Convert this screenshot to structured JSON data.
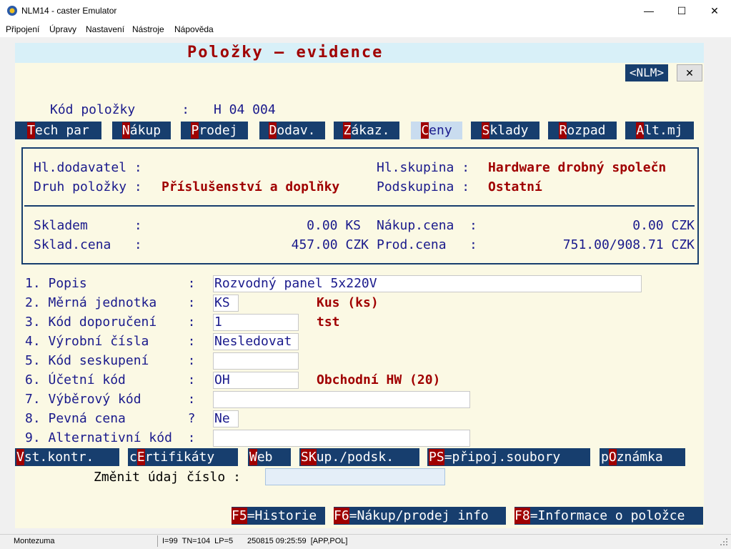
{
  "window": {
    "title": "NLM14 - caster Emulator",
    "minimize": "—",
    "maximize": "☐",
    "close": "✕"
  },
  "menu": [
    "Připojení",
    "Úpravy",
    "Nastavení",
    "Nástroje",
    "Nápověda"
  ],
  "screen": {
    "heading": "Položky – evidence",
    "nlm_tag": "<NLM>",
    "close_x": "✕",
    "item_code_label": "Kód položky      :",
    "item_code_value": "H 04 004"
  },
  "tabs": [
    {
      "key": "T",
      "rest": "ech par"
    },
    {
      "key": "N",
      "rest": "ákup"
    },
    {
      "key": "P",
      "rest": "rodej"
    },
    {
      "key": "D",
      "rest": "odav."
    },
    {
      "key": "Z",
      "rest": "ákaz."
    },
    {
      "key": "C",
      "rest": "eny",
      "active": true
    },
    {
      "key": "S",
      "rest": "klady"
    },
    {
      "key": "R",
      "rest": "ozpad"
    },
    {
      "key": "A",
      "rest": "lt.mj"
    }
  ],
  "info": {
    "hl_dodavatel_label": "Hl.dodavatel :",
    "hl_dodavatel_value": "",
    "druh_label": "Druh položky :",
    "druh_value": "Příslušenství a doplňky",
    "hl_skupina_label": "Hl.skupina :",
    "hl_skupina_value": "Hardware drobný společn",
    "podskupina_label": "Podskupina :",
    "podskupina_value": "Ostatní",
    "skladem_label": "Skladem      :",
    "skladem_value": "0.00 KS",
    "sklad_cena_label": "Sklad.cena   :",
    "sklad_cena_value": "457.00 CZK",
    "nakup_cena_label": "Nákup.cena  :",
    "nakup_cena_value": "0.00 CZK",
    "prod_cena_label": "Prod.cena   :",
    "prod_cena_value": "751.00/908.71 CZK"
  },
  "fields": [
    {
      "label": "1. Popis             :",
      "value": "Rozvodný panel 5x220V",
      "note": ""
    },
    {
      "label": "2. Měrná jednotka    :",
      "value": "KS",
      "note": "Kus (ks)"
    },
    {
      "label": "3. Kód doporučení    :",
      "value": "1",
      "note": "tst"
    },
    {
      "label": "4. Výrobní čísla     :",
      "value": "Nesledovat",
      "note": ""
    },
    {
      "label": "5. Kód seskupení     :",
      "value": "",
      "note": ""
    },
    {
      "label": "6. Účetní kód        :",
      "value": "OH",
      "note": "Obchodní HW (20)"
    },
    {
      "label": "7. Výběrový kód      :",
      "value": "",
      "note": ""
    },
    {
      "label": "8. Pevná cena        ?",
      "value": "Ne",
      "note": ""
    },
    {
      "label": "9. Alternativní kód  :",
      "value": "",
      "note": ""
    }
  ],
  "actions": [
    {
      "pre": "",
      "key": "V",
      "rest": "st.kontr."
    },
    {
      "pre": "c",
      "key": "E",
      "rest": "rtifikáty"
    },
    {
      "pre": "",
      "key": "W",
      "rest": "eb"
    },
    {
      "pre": "",
      "key": "SK",
      "rest": "up./podsk."
    },
    {
      "pre": "",
      "key": "PS",
      "rest": "=připoj.soubory"
    },
    {
      "pre": "p",
      "key": "O",
      "rest": "známka"
    }
  ],
  "change_prompt": "Změnit údaj číslo :",
  "change_value": "",
  "fkeys": [
    {
      "key": "F5",
      "rest": "=Historie"
    },
    {
      "key": "F6",
      "rest": "=Nákup/prodej info"
    },
    {
      "key": "F8",
      "rest": "=Informace o položce"
    }
  ],
  "status": {
    "user": "Montezuma",
    "info": "I=99  TN=104  LP=5",
    "datetime": "250815 09:25:59  [APP,POL]"
  },
  "colors": {
    "navy": "#173e6e",
    "hotkey": "#a00000",
    "screen_bg": "#fbf9e4"
  }
}
